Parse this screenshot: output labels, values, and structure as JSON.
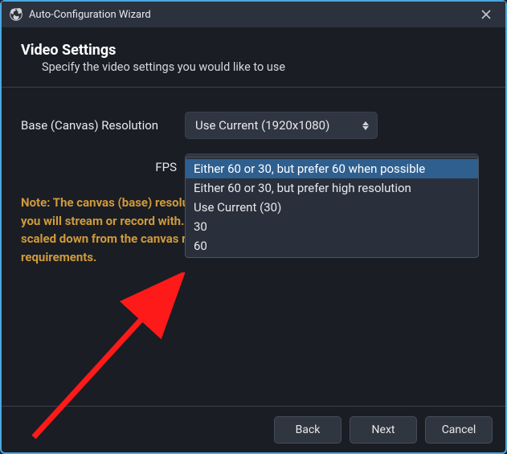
{
  "window": {
    "title": "Auto-Configuration Wizard"
  },
  "header": {
    "title": "Video Settings",
    "subtitle": "Specify the video settings you would like to use"
  },
  "fields": {
    "resolution_label": "Base (Canvas) Resolution",
    "resolution_value": "Use Current (1920x1080)",
    "fps_label": "FPS",
    "fps_value": "Either 60 or 30, but prefer 60 when possible"
  },
  "dropdown": {
    "options": [
      "Either 60 or 30, but prefer 60 when possible",
      "Either 60 or 30, but prefer high resolution",
      "Use Current (30)",
      "30",
      "60"
    ]
  },
  "note": "Note: The canvas (base) resolution is not necessarily the same as the resolution you will stream or record with. Your actual streaming/recording resolution may be scaled down from the canvas resolution to reduce resource usage or bitrate requirements.",
  "buttons": {
    "back": "Back",
    "next": "Next",
    "cancel": "Cancel"
  }
}
